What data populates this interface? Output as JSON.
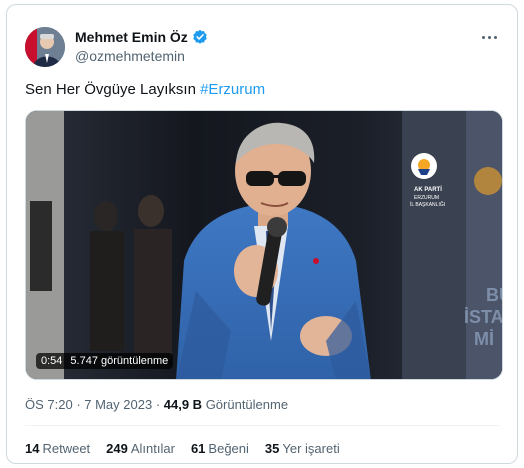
{
  "author": {
    "name": "Mehmet Emin Öz",
    "handle": "@ozmehmetemin"
  },
  "icons": {
    "verified": "verified-badge-icon",
    "more": "more-options-icon"
  },
  "tweet": {
    "text": "Sen Her Övgüye Layıksın ",
    "hashtag": "#Erzurum"
  },
  "media": {
    "duration": "0:54",
    "views_label": "5.747 görüntülenme",
    "logo_text": [
      "AK PARTİ",
      "ERZURUM",
      "İL BAŞKANLIĞI"
    ],
    "backdrop_text": "BU\nİSTA\nMİ"
  },
  "meta": {
    "time": "ÖS 7:20",
    "separator1": " · ",
    "date": "7 May 2023",
    "separator2": " · ",
    "views_count": "44,9 B",
    "views_label": " Görüntülenme"
  },
  "stats": [
    {
      "count": "14",
      "label": "Retweet"
    },
    {
      "count": "249",
      "label": "Alıntılar"
    },
    {
      "count": "61",
      "label": "Beğeni"
    },
    {
      "count": "35",
      "label": "Yer işareti"
    }
  ],
  "colors": {
    "accent": "#1d9bf0",
    "text": "#0f1419",
    "muted": "#536471",
    "border": "#cfd9de"
  }
}
